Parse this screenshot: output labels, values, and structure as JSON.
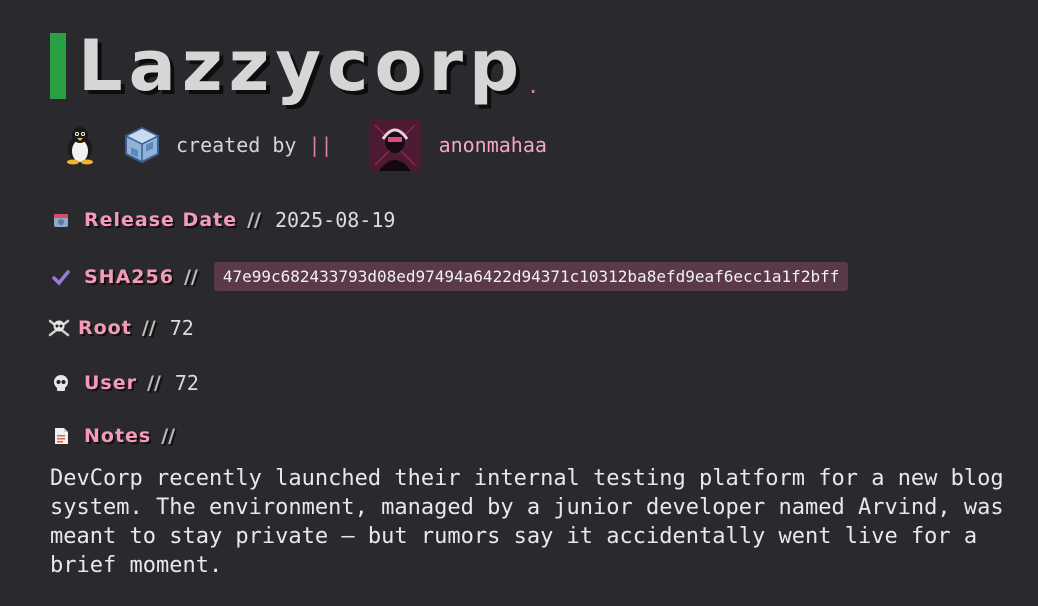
{
  "header": {
    "title": "Lazzycorp",
    "title_dot": ".",
    "accent_color": "#2aa044"
  },
  "meta": {
    "os_icon": "linux-penguin-icon",
    "platform_icon": "virtualbox-icon",
    "created_by_label": "created by",
    "separator": "||",
    "author": "anonmahaa",
    "author_color": "#f5a6c6"
  },
  "fields": {
    "release": {
      "icon": "calendar-icon",
      "label": "Release Date",
      "sep": "//",
      "value": "2025-08-19"
    },
    "sha": {
      "icon": "checkmark-icon",
      "label": "SHA256",
      "sep": "//",
      "value": "47e99c682433793d08ed97494a6422d94371c10312ba8efd9eaf6ecc1a1f2bff"
    },
    "root": {
      "icon": "skull-crossbones-icon",
      "label": "Root",
      "sep": "//",
      "value": "72"
    },
    "user": {
      "icon": "skull-icon",
      "label": "User",
      "sep": "//",
      "value": "72"
    },
    "notes": {
      "icon": "document-icon",
      "label": "Notes",
      "sep": "//"
    }
  },
  "notes_text": "DevCorp recently launched their internal testing platform for a new blog system. The environment, managed by a junior developer named Arvind, was meant to stay private — but rumors say it accidentally went live for a brief moment.",
  "colors": {
    "background": "#2a2a2e",
    "label_pink": "#f59ab8",
    "hash_bg": "#5a3a4a"
  }
}
